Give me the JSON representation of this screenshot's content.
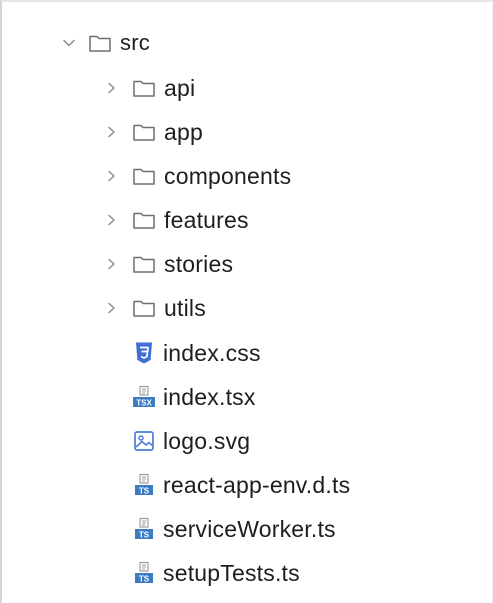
{
  "tree": {
    "root": {
      "label": "src",
      "icon": "folder-outline-icon",
      "expanded": true
    },
    "folders": [
      {
        "label": "api",
        "icon": "folder-outline-icon",
        "expanded": false
      },
      {
        "label": "app",
        "icon": "folder-outline-icon",
        "expanded": false
      },
      {
        "label": "components",
        "icon": "folder-outline-icon",
        "expanded": false
      },
      {
        "label": "features",
        "icon": "folder-outline-icon",
        "expanded": false
      },
      {
        "label": "stories",
        "icon": "folder-outline-icon",
        "expanded": false
      },
      {
        "label": "utils",
        "icon": "folder-outline-icon",
        "expanded": false
      }
    ],
    "files": [
      {
        "label": "index.css",
        "icon": "css-file-icon"
      },
      {
        "label": "index.tsx",
        "icon": "tsx-file-icon"
      },
      {
        "label": "logo.svg",
        "icon": "svg-image-file-icon"
      },
      {
        "label": "react-app-env.d.ts",
        "icon": "ts-file-icon"
      },
      {
        "label": "serviceWorker.ts",
        "icon": "ts-file-icon"
      },
      {
        "label": "setupTests.ts",
        "icon": "ts-file-icon"
      }
    ],
    "icon_labels": {
      "tsx": "TSX",
      "ts": "TS"
    }
  },
  "colors": {
    "folder_stroke": "#6e6e6e",
    "chevron": "#8c8c8c",
    "css_blue": "#3f6fd6",
    "ts_blue": "#3b7bc4",
    "svg_blue": "#4a7fd8",
    "doc_gray": "#a0a0a0"
  }
}
